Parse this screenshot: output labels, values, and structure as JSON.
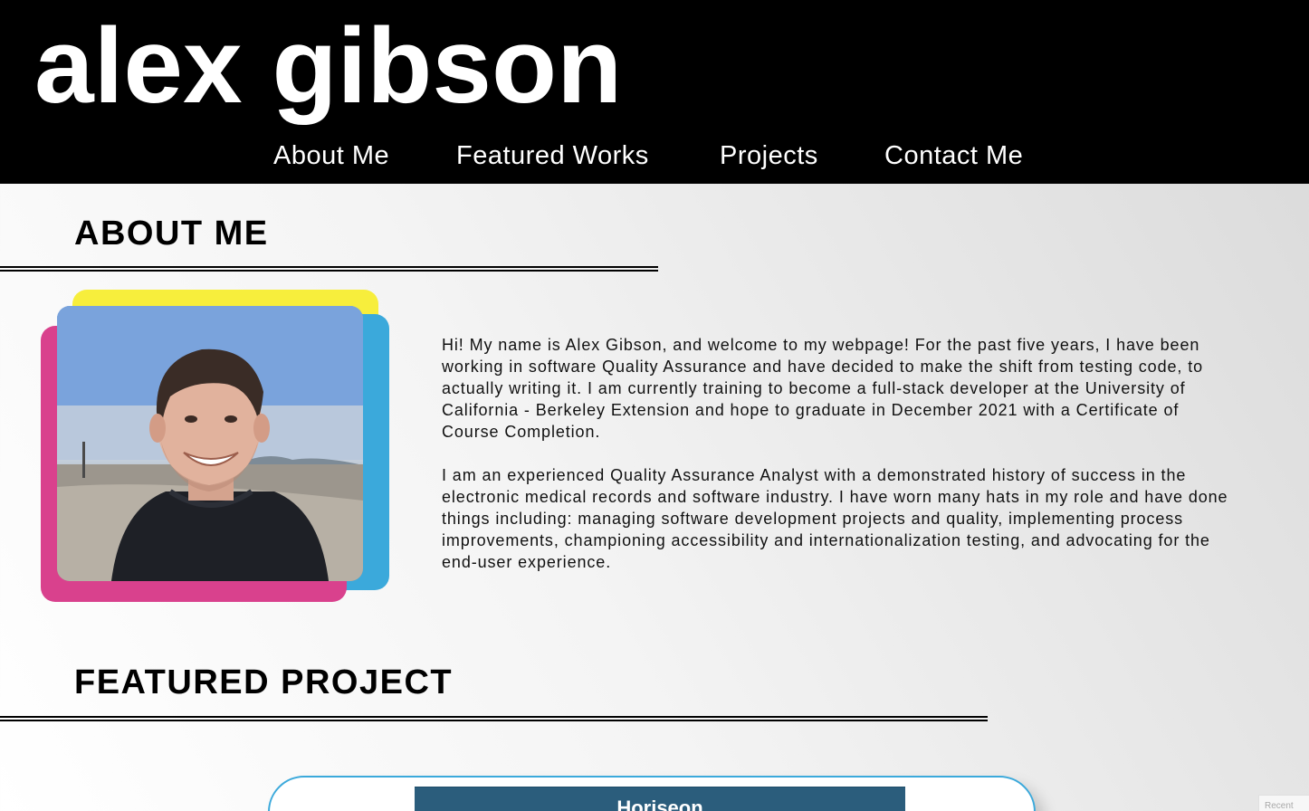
{
  "header": {
    "site_title": "alex gibson",
    "nav": [
      {
        "label": "About Me"
      },
      {
        "label": "Featured Works"
      },
      {
        "label": "Projects"
      },
      {
        "label": "Contact Me"
      }
    ]
  },
  "about": {
    "heading": "ABOUT ME",
    "paragraphs": [
      "Hi! My name is Alex Gibson, and welcome to my webpage! For the past five years, I have been working in software Quality Assurance and have decided to make the shift from testing code, to actually writing it. I am currently training to become a full-stack developer at the University of California - Berkeley Extension and hope to graduate in December 2021 with a Certificate of Course Completion.",
      "I am an experienced Quality Assurance Analyst with a demonstrated history of success in the electronic medical records and software industry. I have worn many hats in my role and have done things including: managing software development projects and quality, implementing process improvements, championing accessibility and internationalization testing, and advocating for the end-user experience."
    ],
    "photo_card_colors": {
      "yellow": "#f7ee3c",
      "blue": "#3ba9db",
      "pink": "#d9418d"
    }
  },
  "featured": {
    "heading": "FEATURED PROJECT",
    "project_title": "Horiseon"
  },
  "corner_tab": "Recent",
  "colors": {
    "header_bg": "#000000",
    "header_text": "#ffffff",
    "accent_border": "#3ba9db"
  }
}
